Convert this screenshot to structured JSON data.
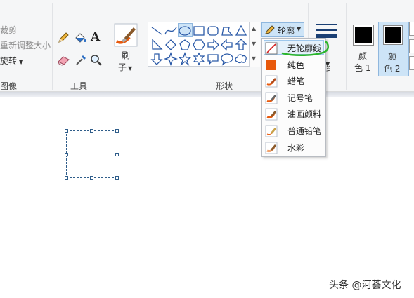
{
  "image_group": {
    "crop_label": "裁剪",
    "resize_label": "重新调整大小",
    "rotate_label": "旋转",
    "group_label": "图像"
  },
  "tools_group": {
    "group_label": "工具"
  },
  "brushes": {
    "label_line1": "刷",
    "label_line2": "子"
  },
  "shapes_group": {
    "group_label": "形状"
  },
  "outline": {
    "button_label": "轮廓",
    "menu_items": [
      {
        "label": "无轮廓线",
        "icon": "no-outline-icon"
      },
      {
        "label": "纯色",
        "icon": "solid-color-icon"
      },
      {
        "label": "蜡笔",
        "icon": "crayon-icon"
      },
      {
        "label": "记号笔",
        "icon": "marker-icon"
      },
      {
        "label": "油画颜料",
        "icon": "oil-paint-icon"
      },
      {
        "label": "普通铅笔",
        "icon": "pencil-icon"
      },
      {
        "label": "水彩",
        "icon": "watercolor-icon"
      }
    ]
  },
  "size": {
    "partial_label": "细"
  },
  "colors": {
    "color1_line1": "颜",
    "color1_line2": "色 1",
    "color2_line1": "颜",
    "color2_line2": "色 2",
    "color1_value": "#000000",
    "color2_value": "#000000"
  },
  "theme": {
    "accent": "#cde4f7",
    "highlight_green": "#2bb52b",
    "selection_color": "#2f5d8a",
    "swatch_orange": "#e8590c"
  },
  "watermark": {
    "text": "头条 @河荟文化"
  }
}
